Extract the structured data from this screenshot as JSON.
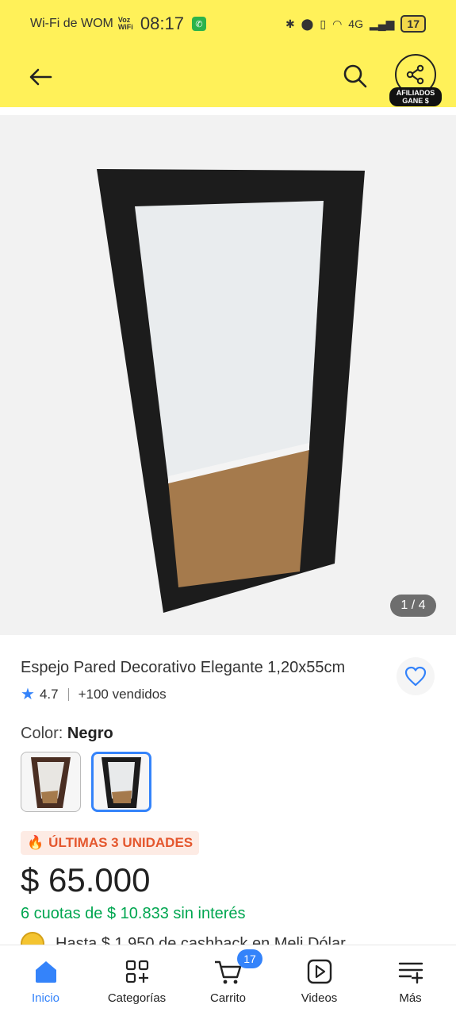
{
  "status_bar": {
    "carrier": "Wi-Fi de WOM",
    "voz_wifi": "Voz WiFi",
    "time": "08:17",
    "network": "4G",
    "battery": "17"
  },
  "header": {
    "afiliados_line1": "AFILIADOS",
    "afiliados_line2": "GANE $"
  },
  "gallery": {
    "counter": "1 / 4"
  },
  "product": {
    "title": "Espejo Pared Decorativo Elegante 1,20x55cm",
    "rating": "4.7",
    "sold": "+100 vendidos",
    "color_label": "Color:",
    "color_value": "Negro",
    "stock_badge": "ÚLTIMAS 3 UNIDADES",
    "price": "$ 65.000",
    "installments": "6 cuotas de $ 10.833 sin interés",
    "cashback": "Hasta $ 1.950 de cashback en Meli Dólar"
  },
  "bottom_nav": {
    "items": [
      {
        "label": "Inicio",
        "icon": "home-icon"
      },
      {
        "label": "Categorías",
        "icon": "categories-icon"
      },
      {
        "label": "Carrito",
        "icon": "cart-icon"
      },
      {
        "label": "Videos",
        "icon": "video-icon"
      },
      {
        "label": "Más",
        "icon": "menu-add-icon"
      }
    ],
    "cart_count": "17"
  },
  "colors": {
    "header_bg": "#fff159",
    "accent": "#3483fa",
    "green": "#00a650",
    "stock_orange": "#e4572e"
  }
}
